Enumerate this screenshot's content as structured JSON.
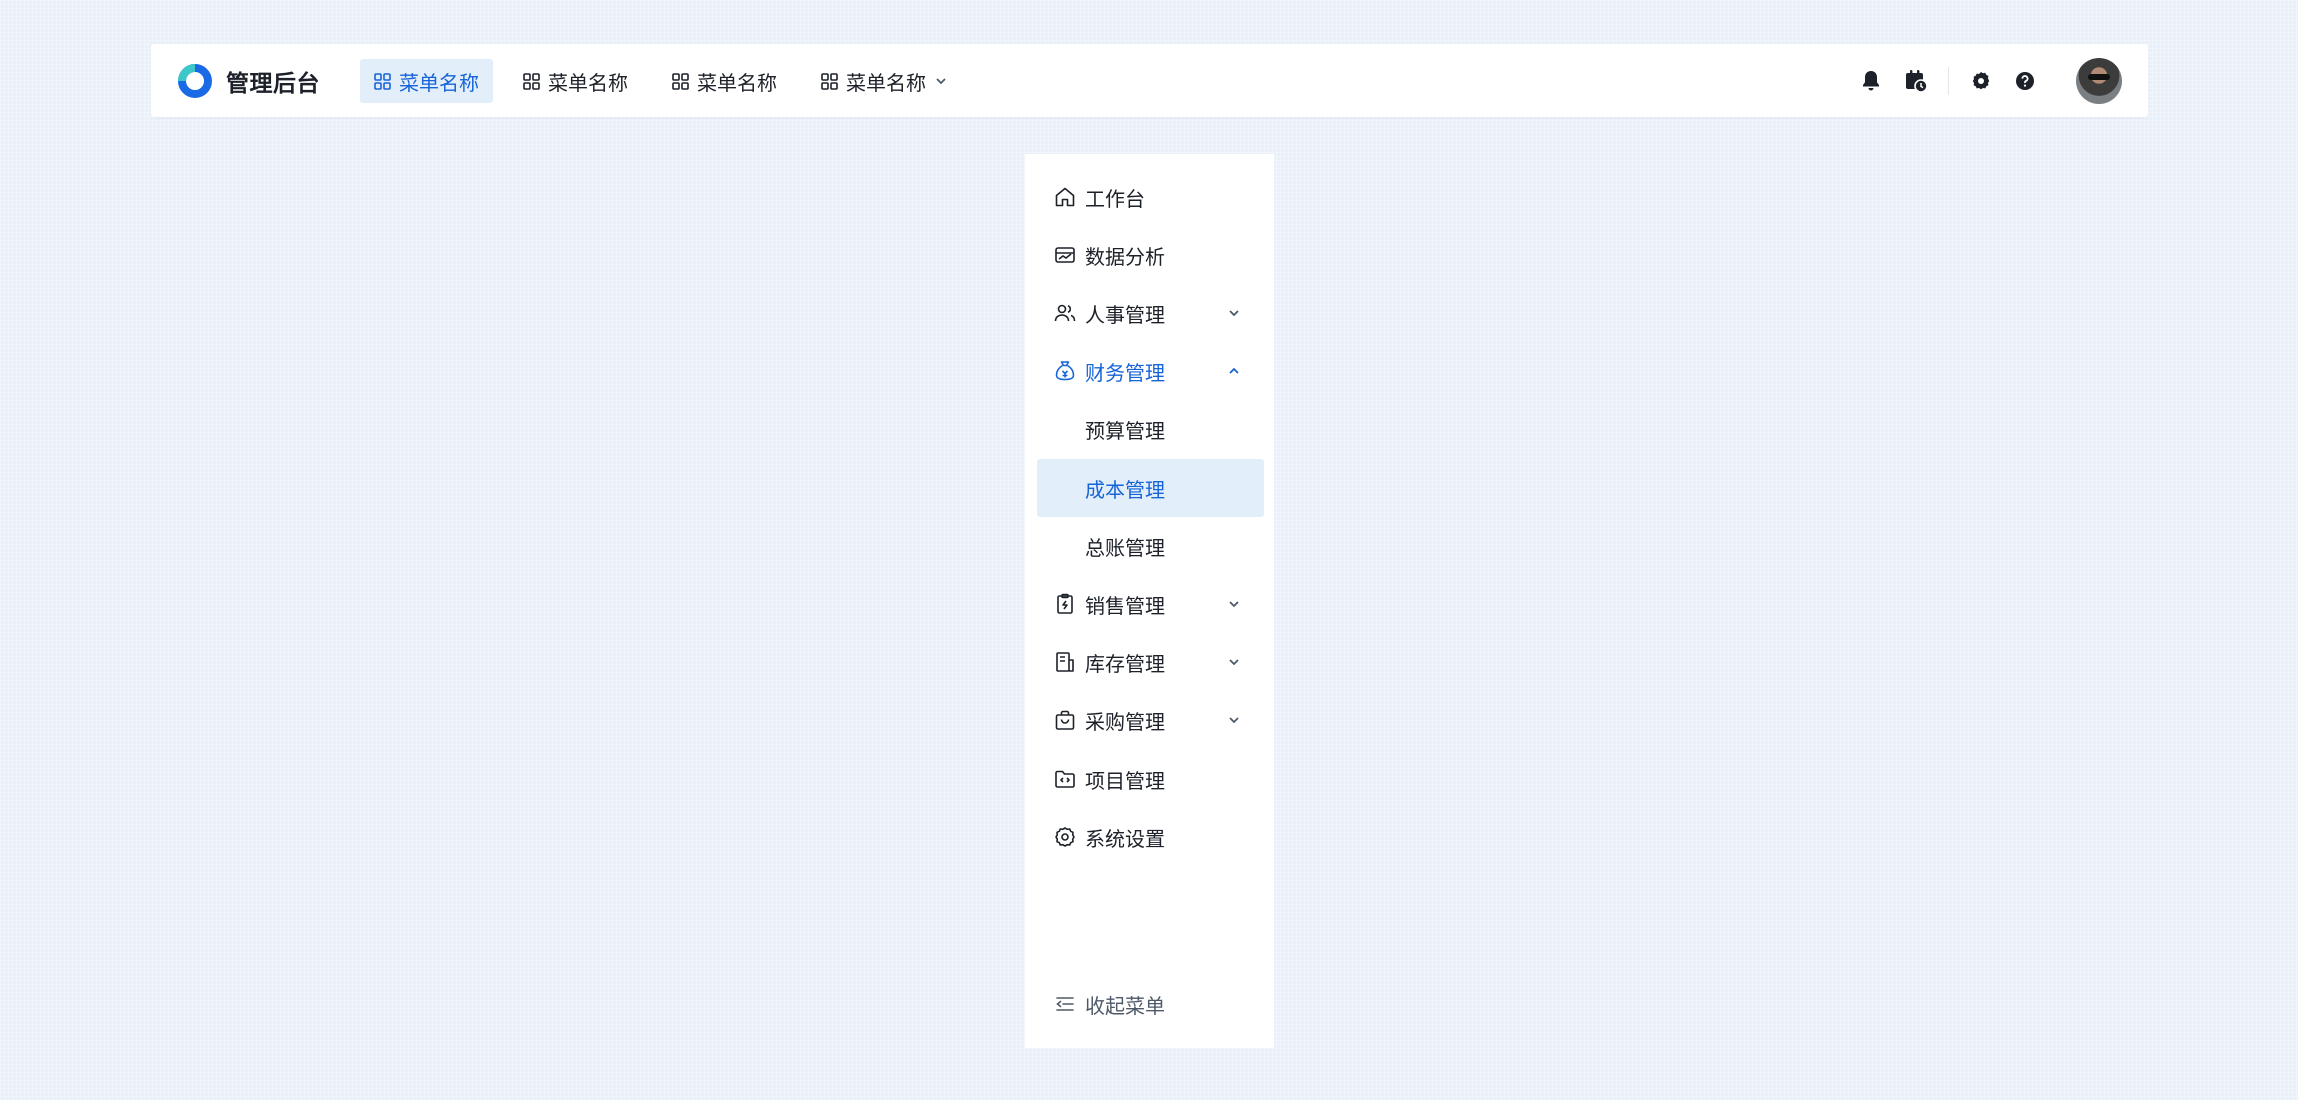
{
  "brand": {
    "title": "管理后台",
    "logo_icon": "logo-icon"
  },
  "topnav": {
    "items": [
      {
        "label": "菜单名称",
        "icon": "grid-icon",
        "active": true
      },
      {
        "label": "菜单名称",
        "icon": "grid-icon"
      },
      {
        "label": "菜单名称",
        "icon": "grid-icon"
      },
      {
        "label": "菜单名称",
        "icon": "grid-icon",
        "has_dropdown": true
      }
    ]
  },
  "header_actions": [
    "bell-icon",
    "calendar-clock-icon",
    "gear-icon",
    "help-icon",
    "avatar"
  ],
  "sidemenu": {
    "items": [
      {
        "label": "工作台",
        "icon": "home-icon"
      },
      {
        "label": "数据分析",
        "icon": "chart-card-icon"
      },
      {
        "label": "人事管理",
        "icon": "users-icon",
        "expandable": true
      },
      {
        "label": "财务管理",
        "icon": "money-bag-icon",
        "expandable": true,
        "expanded": true,
        "children": [
          {
            "label": "预算管理"
          },
          {
            "label": "成本管理",
            "selected": true
          },
          {
            "label": "总账管理"
          }
        ]
      },
      {
        "label": "销售管理",
        "icon": "clipboard-icon",
        "expandable": true
      },
      {
        "label": "库存管理",
        "icon": "inventory-icon",
        "expandable": true
      },
      {
        "label": "采购管理",
        "icon": "shopping-bag-icon",
        "expandable": true
      },
      {
        "label": "项目管理",
        "icon": "folder-code-icon"
      },
      {
        "label": "系统设置",
        "icon": "settings-icon"
      }
    ],
    "collapse_label": "收起菜单"
  },
  "colors": {
    "accent": "#1664d8",
    "active_bg": "#e3eefb",
    "text": "#1d2129",
    "page_bg": "#e8f0f9"
  }
}
